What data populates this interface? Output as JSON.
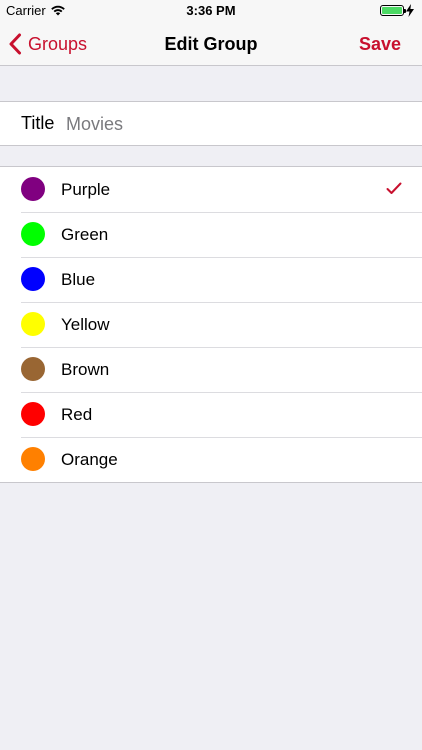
{
  "status_bar": {
    "carrier": "Carrier",
    "time": "3:36 PM",
    "wifi_icon": "wifi-icon",
    "battery_icon": "battery-icon",
    "charging_icon": "charging-bolt-icon",
    "battery_level": 1.0
  },
  "nav": {
    "back_label": "Groups",
    "back_icon": "chevron-left-icon",
    "title": "Edit Group",
    "save_label": "Save"
  },
  "form": {
    "title_label": "Title",
    "title_value": "Movies"
  },
  "colors": {
    "accent": "#c8102e",
    "items": [
      {
        "label": "Purple",
        "color": "#800080",
        "selected": true
      },
      {
        "label": "Green",
        "color": "#00ff00",
        "selected": false
      },
      {
        "label": "Blue",
        "color": "#0000ff",
        "selected": false
      },
      {
        "label": "Yellow",
        "color": "#ffff00",
        "selected": false
      },
      {
        "label": "Brown",
        "color": "#996633",
        "selected": false
      },
      {
        "label": "Red",
        "color": "#ff0000",
        "selected": false
      },
      {
        "label": "Orange",
        "color": "#ff8000",
        "selected": false
      }
    ],
    "check_icon": "checkmark-icon"
  }
}
